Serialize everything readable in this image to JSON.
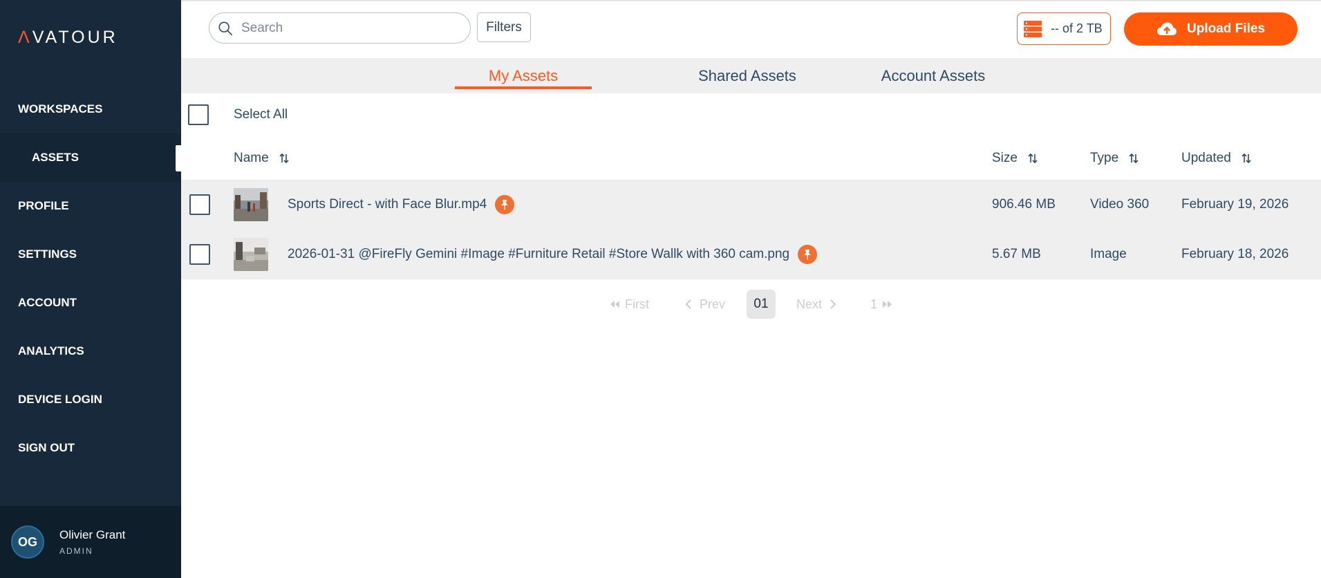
{
  "app": {
    "logo_text": "VATOUR",
    "logo_mark": "Λ"
  },
  "sidebar": {
    "items": [
      {
        "label": "WORKSPACES"
      },
      {
        "label": "ASSETS"
      },
      {
        "label": "PROFILE"
      },
      {
        "label": "SETTINGS"
      },
      {
        "label": "ACCOUNT"
      },
      {
        "label": "ANALYTICS"
      },
      {
        "label": "DEVICE LOGIN"
      },
      {
        "label": "SIGN OUT"
      }
    ],
    "active_item": "ASSETS"
  },
  "user": {
    "initials": "OG",
    "name": "Olivier Grant",
    "role": "ADMIN"
  },
  "search": {
    "placeholder": "Search",
    "value": ""
  },
  "filters": {
    "label": "Filters"
  },
  "storage": {
    "text": "-- of 2 TB",
    "icon": "storage-stack-icon"
  },
  "upload": {
    "label": "Upload Files",
    "icon": "cloud-upload-icon"
  },
  "tabs": [
    {
      "label": "My Assets",
      "active": true
    },
    {
      "label": "Shared Assets",
      "active": false
    },
    {
      "label": "Account Assets",
      "active": false
    }
  ],
  "select_all": {
    "label": "Select All"
  },
  "columns": {
    "name": "Name",
    "size": "Size",
    "type": "Type",
    "updated": "Updated"
  },
  "assets": [
    {
      "name": "Sports Direct - with Face Blur.mp4",
      "size": "906.46 MB",
      "type": "Video 360",
      "updated": "February 19, 2026",
      "pinned": true
    },
    {
      "name": "2026-01-31 @FireFly Gemini #Image #Furniture Retail #Store Wallk with 360 cam.png",
      "size": "5.67 MB",
      "type": "Image",
      "updated": "February 18, 2026",
      "pinned": true
    }
  ],
  "pagination": {
    "first": "First",
    "prev": "Prev",
    "current": "01",
    "next": "Next",
    "last": "1"
  },
  "colors": {
    "accent": "#ff5a1f",
    "sidebar": "#17293a",
    "text": "#2c4a63",
    "row_bg": "#efefef"
  }
}
